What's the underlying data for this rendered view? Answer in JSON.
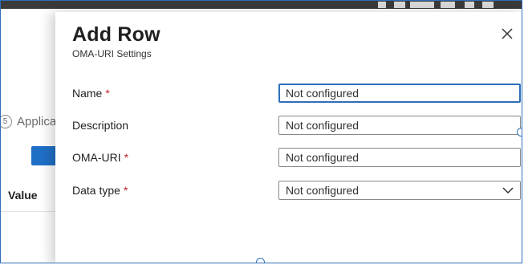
{
  "background_page": {
    "step_number": "5",
    "step_label": "Applica",
    "column_header": "Value"
  },
  "panel": {
    "title": "Add Row",
    "subtitle": "OMA-URI Settings",
    "close_icon": "close-icon",
    "fields": [
      {
        "label": "Name",
        "required": true,
        "value": "Not configured",
        "type": "text",
        "focused": true
      },
      {
        "label": "Description",
        "required": false,
        "value": "Not configured",
        "type": "text",
        "focused": false
      },
      {
        "label": "OMA-URI",
        "required": true,
        "value": "Not configured",
        "type": "text",
        "focused": false
      },
      {
        "label": "Data type",
        "required": true,
        "value": "Not configured",
        "type": "select",
        "focused": false
      }
    ],
    "required_marker": "*"
  },
  "colors": {
    "accent": "#2f6fb8",
    "required": "#c4262e",
    "primary_button": "#1f6fc7"
  }
}
